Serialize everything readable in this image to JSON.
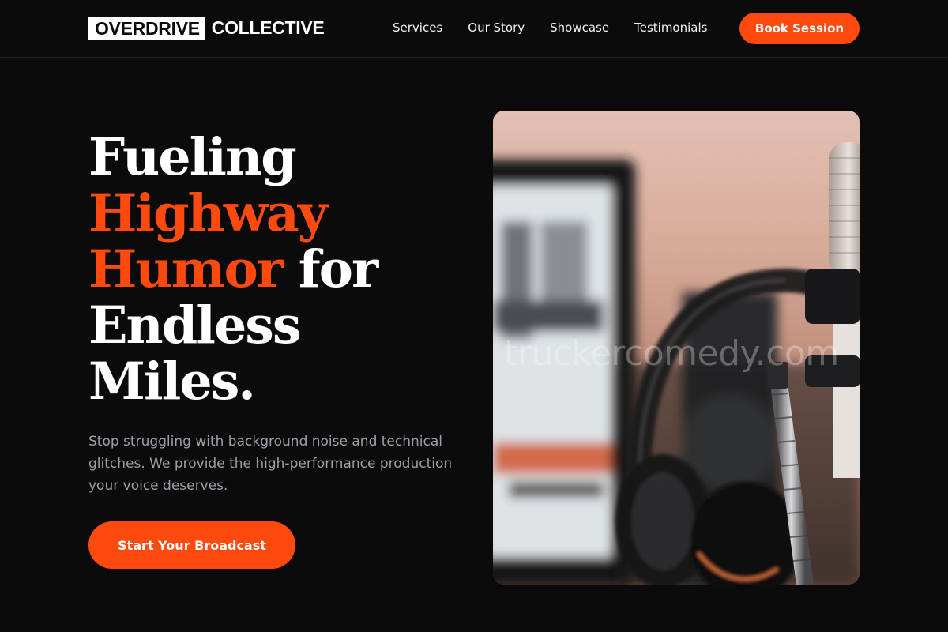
{
  "header": {
    "logo_box": "OVERDRIVE",
    "logo_rest": "COLLECTIVE",
    "nav": [
      "Services",
      "Our Story",
      "Showcase",
      "Testimonials"
    ],
    "cta": "Book Session"
  },
  "hero": {
    "headline": {
      "line1": "Fueling",
      "line2": "Highway",
      "line3_accent": "Humor",
      "line3_rest": " for",
      "line4": "Endless",
      "line5": "Miles."
    },
    "subtext": "Stop struggling with background noise and technical glitches. We provide the high-performance production your voice deserves.",
    "cta": "Start Your Broadcast",
    "image_watermark": "truckercomedy.com"
  },
  "colors": {
    "background": "#0b0b0c",
    "accent": "#ff4a0f",
    "text": "#ffffff",
    "muted_text": "#9ca0aa"
  },
  "icons": [
    "studio-photo-microphone-headphones"
  ]
}
